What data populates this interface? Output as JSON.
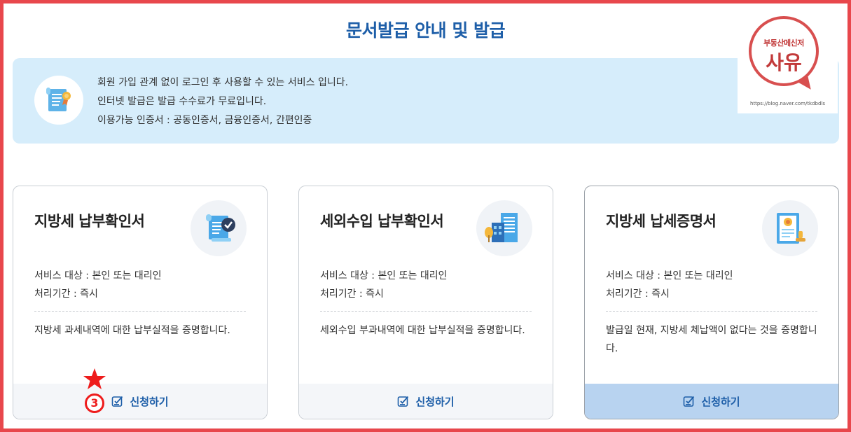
{
  "page": {
    "title": "문서발급 안내 및 발급"
  },
  "info": {
    "lines": [
      "회원 가입 관계 없이 로그인 후 사용할 수 있는 서비스 입니다.",
      "인터넷 발급은 발급 수수료가 무료입니다.",
      "이용가능 인증서 : 공동인증서, 금융인증서, 간편인증"
    ]
  },
  "watermark": {
    "top": "부동산메신저",
    "main": "사유",
    "url": "https://blog.naver.com/tkdbdls"
  },
  "cards": [
    {
      "title": "지방세 납부확인서",
      "target": "서비스 대상 : 본인 또는 대리인",
      "period": "처리기간 : 즉시",
      "desc": "지방세 과세내역에 대한 납부실적을 증명합니다.",
      "apply": "신청하기",
      "icon": "document-check-icon"
    },
    {
      "title": "세외수입 납부확인서",
      "target": "서비스 대상 : 본인 또는 대리인",
      "period": "처리기간 : 즉시",
      "desc": "세외수입 부과내역에 대한 납부실적을 증명합니다.",
      "apply": "신청하기",
      "icon": "building-icon"
    },
    {
      "title": "지방세 납세증명서",
      "target": "서비스 대상 : 본인 또는 대리인",
      "period": "처리기간 : 즉시",
      "desc": "발급일 현재, 지방세 체납액이 없다는 것을 증명합니다.",
      "apply": "신청하기",
      "icon": "certificate-stamp-icon"
    }
  ],
  "annotation": {
    "step": "3",
    "marker": "star-icon"
  },
  "colors": {
    "frame": "#e8474c",
    "title": "#1d5ea8",
    "info_bg": "#d6edfb",
    "active_footer": "#b8d3f0",
    "annotation": "#ee1c1c"
  }
}
